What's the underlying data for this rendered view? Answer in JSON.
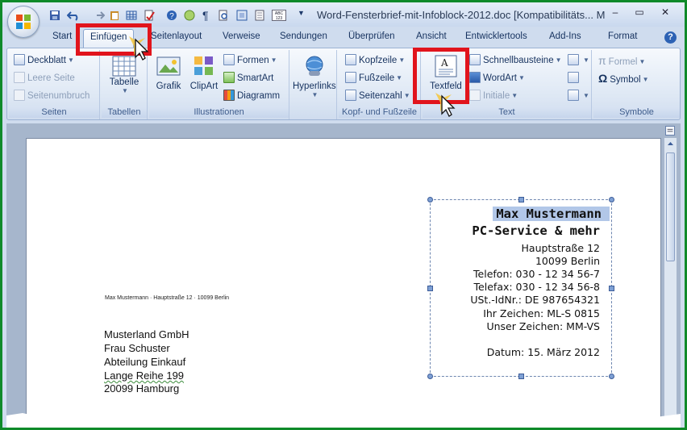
{
  "window": {
    "title": "Word-Fensterbrief-mit-Infoblock-2012.doc [Kompatibilitäts...   M",
    "minimize": "–",
    "maximize": "▭",
    "close": "✕"
  },
  "tabs": [
    {
      "label": "Start"
    },
    {
      "label": "Einfügen"
    },
    {
      "label": "Seitenlayout"
    },
    {
      "label": "Verweise"
    },
    {
      "label": "Sendungen"
    },
    {
      "label": "Überprüfen"
    },
    {
      "label": "Ansicht"
    },
    {
      "label": "Entwicklertools"
    },
    {
      "label": "Add-Ins"
    },
    {
      "label": "Format"
    }
  ],
  "help": "?",
  "ribbon": {
    "seiten": {
      "label": "Seiten",
      "items": [
        "Deckblatt",
        "Leere Seite",
        "Seitenumbruch"
      ]
    },
    "tabellen": {
      "label": "Tabellen",
      "tabelle": "Tabelle"
    },
    "illustrationen": {
      "label": "Illustrationen",
      "grafik": "Grafik",
      "clipart": "ClipArt",
      "formen": "Formen",
      "smartart": "SmartArt",
      "diagramm": "Diagramm"
    },
    "hyperlinks": {
      "label": "Hyperlinks"
    },
    "kopf": {
      "label": "Kopf- und Fußzeile",
      "items": [
        "Kopfzeile",
        "Fußzeile",
        "Seitenzahl"
      ]
    },
    "text": {
      "label": "Text",
      "textfeld": "Textfeld",
      "items": [
        "Schnellbausteine",
        "WordArt",
        "Initiale"
      ]
    },
    "symbole": {
      "label": "Symbole",
      "formel": "Formel",
      "symbol": "Symbol",
      "formel_glyph": "π",
      "symbol_glyph": "Ω"
    }
  },
  "document": {
    "sender_line": "Max Mustermann · Hauptstraße 12 · 10099 Berlin",
    "recipient": [
      "Musterland GmbH",
      "Frau Schuster",
      "Abteilung Einkauf",
      "Lange Reihe 199",
      "20099 Hamburg"
    ],
    "infoblock": {
      "name": "Max Mustermann",
      "company": "PC-Service & mehr",
      "street": "Hauptstraße 12",
      "city": "10099 Berlin",
      "phone": "Telefon: 030 - 12 34 56-7",
      "fax": "Telefax: 030 - 12 34 56-8",
      "vat": "USt.-IdNr.: DE 987654321",
      "your_ref": "Ihr Zeichen: ML-S 0815",
      "our_ref": "Unser Zeichen: MM-VS",
      "date": "Datum: 15. März 2012"
    }
  },
  "colors": {
    "highlight": "#e1141c",
    "frame": "#0f8a2a",
    "selection": "#b2c7e8"
  }
}
